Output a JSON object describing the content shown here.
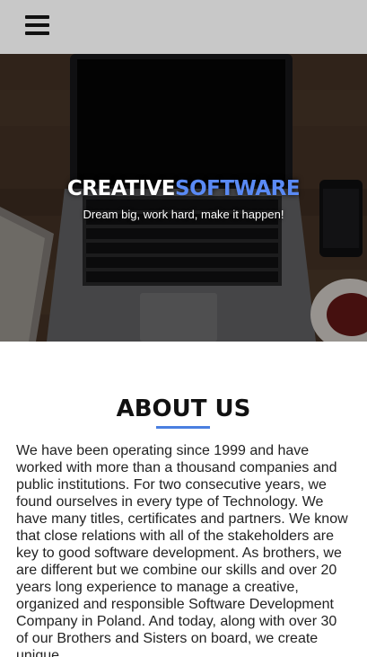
{
  "nav": {
    "menu_icon": "hamburger-menu-icon"
  },
  "hero": {
    "title_part1": "CREATIVE",
    "title_part2": "SOFTWARE",
    "subtitle": "Dream big, work hard, make it happen!",
    "accent_color": "#5a8af5"
  },
  "about": {
    "title": "ABOUT US",
    "underline_color": "#4a7fe0",
    "body": "We have been operating since 1999 and have worked with more than a thousand companies and public institutions. For two consecutive years, we found ourselves in every type of Technology. We have many titles, certificates and partners. We know that close relations with all of the stakeholders are key to good software development. As brothers, we are different but we combine our skills and over 20 years long experience to manage a creative, organized and responsible Software Development Company in Poland. And today, along with over 30 of our Brothers and Sisters on board, we create unique"
  }
}
